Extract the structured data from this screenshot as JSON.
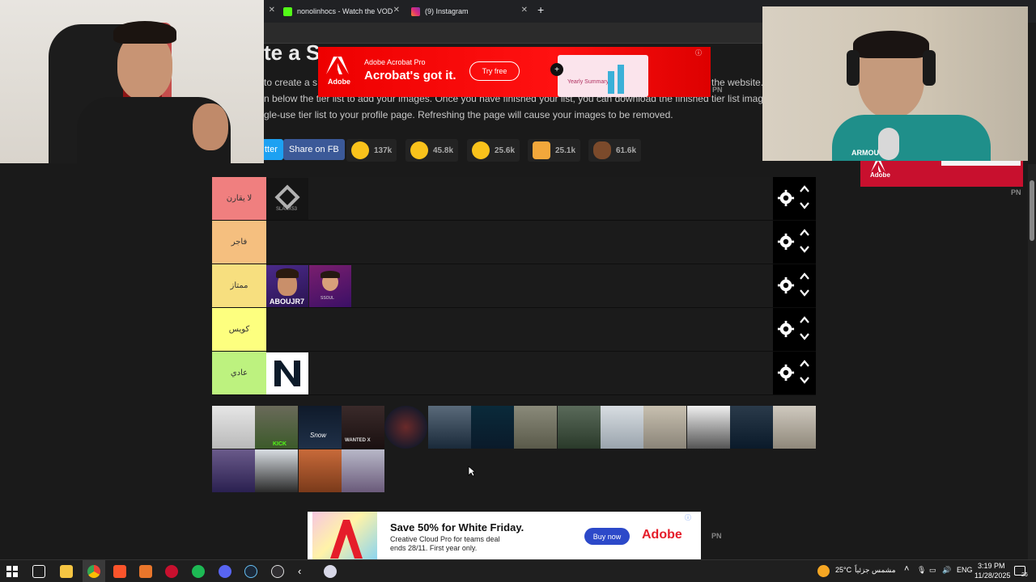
{
  "browser": {
    "tabs": [
      {
        "title": "nonolinhocs - Watch the VOD"
      },
      {
        "title": "(9) Instagram"
      }
    ],
    "new_tab": "+",
    "close": "✕"
  },
  "page": {
    "title": "te a S",
    "description_lines": [
      "to create a s",
      "n below the tier list to add your images. Once you have finished your list, you can download the finished tier list image. It is",
      "gle-use tier list to your profile page. Refreshing the page will cause your images to be removed."
    ],
    "desc_tail": "the website.",
    "share_buttons": [
      "tter",
      "Share on FB"
    ],
    "reactions": [
      {
        "icon": "grin-emoji-icon",
        "count": "137k"
      },
      {
        "icon": "heart-eyes-emoji-icon",
        "count": "45.8k"
      },
      {
        "icon": "laughing-emoji-icon",
        "count": "25.6k"
      },
      {
        "icon": "raised-hands-emoji-icon",
        "count": "25.1k"
      },
      {
        "icon": "poop-emoji-icon",
        "count": "61.6k"
      }
    ],
    "watermark_pn": "PN"
  },
  "tiers": [
    {
      "label": "لا يقارن",
      "color": "#f07f7f"
    },
    {
      "label": "فاجر",
      "color": "#f5bf7f"
    },
    {
      "label": "ممتاز",
      "color": "#f7df7f"
    },
    {
      "label": "كويس",
      "color": "#fdff7f"
    },
    {
      "label": "عادي",
      "color": "#bdf27f"
    }
  ],
  "tier_items": {
    "slaxx": "SLAXX53",
    "abou": "ABOUJR7",
    "ssoul": "SSOUL"
  },
  "pool_labels": [
    "Snow",
    "WANTED X",
    "KICK"
  ],
  "ads": {
    "acrobat": {
      "brand": "Adobe",
      "product": "Adobe Acrobat Pro",
      "headline": "Acrobat's got it.",
      "cta": "Try free",
      "mini": "Yearly Summary"
    },
    "cloud": {
      "headline": "Save 50% for White Friday.",
      "line1": "Creative Cloud Pro for teams deal",
      "line2": "ends 28/11. First year only.",
      "cta": "Buy now",
      "brand": "Adobe"
    },
    "side": {
      "brand": "Adobe"
    }
  },
  "webcam": {
    "shirt_text": "ARMOU"
  },
  "taskbar": {
    "weather": "25°C",
    "weather_text": "مشمس جزئياً",
    "lang": "ENG",
    "time": "3:19 PM",
    "date": "11/28/2025",
    "notif": "26"
  }
}
